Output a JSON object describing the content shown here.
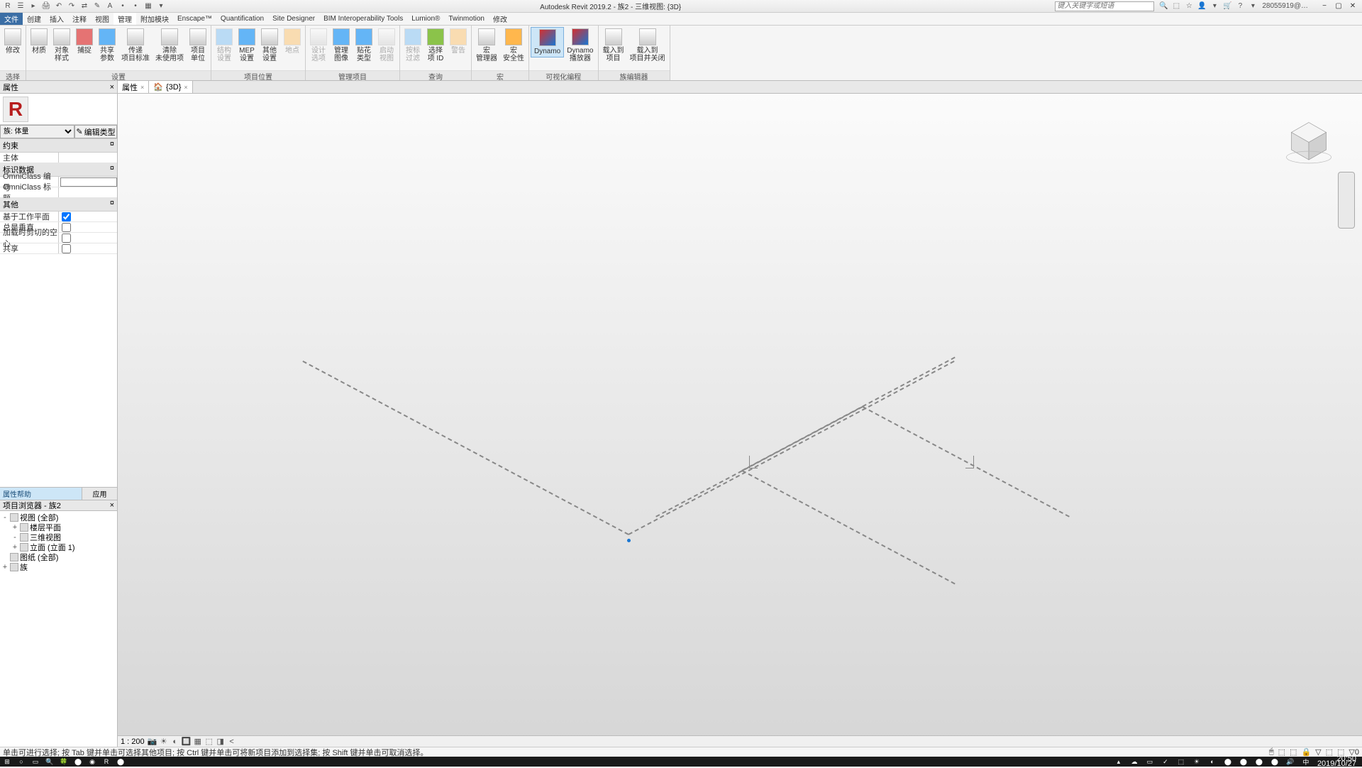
{
  "title": "Autodesk Revit 2019.2 - 族2 - 三维视图: {3D}",
  "qat": [
    "R",
    "☰",
    "▸",
    "🖨",
    "↶",
    "↷",
    "⇄",
    "✎",
    "A",
    "•",
    "•",
    "▦",
    "▾"
  ],
  "infocenter": {
    "search_placeholder": "键入关键字或短语",
    "user": "28055919@…",
    "icons": [
      "🔍",
      "⬚",
      "☆",
      "👤",
      "▾",
      "🛒",
      "?",
      "▾"
    ]
  },
  "tabs": [
    "文件",
    "创建",
    "插入",
    "注释",
    "视图",
    "管理",
    "附加模块",
    "Enscape™",
    "Quantification",
    "Site Designer",
    "BIM Interoperability Tools",
    "Lumion®",
    "Twinmotion",
    "修改"
  ],
  "active_tab": 5,
  "ribbon": [
    {
      "name": "选择",
      "btns": [
        {
          "l": "修改",
          "sub": "",
          "c": "c1"
        }
      ]
    },
    {
      "name": "设置",
      "btns": [
        {
          "l": "材质",
          "c": "c1"
        },
        {
          "l": "对象\n样式",
          "c": "c1"
        },
        {
          "l": "捕捉",
          "c": "c5"
        },
        {
          "l": "共享\n参数",
          "c": "c4"
        },
        {
          "l": "传递\n项目标准",
          "c": "c1"
        },
        {
          "l": "清除\n未使用项",
          "c": "c1"
        },
        {
          "l": "项目\n单位",
          "c": "c1"
        }
      ]
    },
    {
      "name": "项目位置",
      "btns": [
        {
          "l": "结构\n设置",
          "c": "c4",
          "d": true
        },
        {
          "l": "MEP\n设置",
          "c": "c4"
        },
        {
          "l": "其他\n设置",
          "c": "c1"
        },
        {
          "l": "地点",
          "c": "c3",
          "d": true
        }
      ]
    },
    {
      "name": "管理项目",
      "btns": [
        {
          "l": "设计\n选项",
          "c": "c1",
          "d": true
        },
        {
          "l": "管理\n图像",
          "c": "c4"
        },
        {
          "l": "贴花\n类型",
          "c": "c4"
        },
        {
          "l": "启动\n视图",
          "c": "c1",
          "d": true
        }
      ]
    },
    {
      "name": "查询",
      "btns": [
        {
          "l": "按标\n过滤",
          "c": "c4",
          "d": true
        },
        {
          "l": "选择\n项 ID",
          "c": "c2"
        },
        {
          "l": "警告",
          "c": "c3",
          "d": true
        }
      ]
    },
    {
      "name": "宏",
      "btns": [
        {
          "l": "宏\n管理器",
          "c": "c1"
        },
        {
          "l": "宏\n安全性",
          "c": "c3"
        }
      ]
    },
    {
      "name": "可视化编程",
      "btns": [
        {
          "l": "Dynamo",
          "c": "dyn",
          "hl": true
        },
        {
          "l": "Dynamo\n播放器",
          "c": "dyn"
        }
      ]
    },
    {
      "name": "族编辑器",
      "btns": [
        {
          "l": "载入到\n项目",
          "c": "c1"
        },
        {
          "l": "载入到\n项目并关闭",
          "c": "c1"
        }
      ]
    }
  ],
  "doc_tabs": [
    {
      "label": "属性",
      "close": true
    },
    {
      "label": "{3D}",
      "icon": "🏠",
      "close": true
    }
  ],
  "props": {
    "title": "属性",
    "selector": "族: 体量",
    "edit_type": "编辑类型",
    "sections": [
      {
        "name": "约束",
        "rows": [
          {
            "k": "主体",
            "v": ""
          }
        ]
      },
      {
        "name": "标识数据",
        "rows": [
          {
            "k": "OmniClass 编号",
            "v": "",
            "input": true
          },
          {
            "k": "OmniClass 标题",
            "v": ""
          }
        ]
      },
      {
        "name": "其他",
        "rows": [
          {
            "k": "基于工作平面",
            "cb": true,
            "checked": true
          },
          {
            "k": "总是垂直",
            "cb": true,
            "checked": false
          },
          {
            "k": "加载时剪切的空心",
            "cb": true,
            "checked": false
          },
          {
            "k": "共享",
            "cb": true,
            "checked": false
          }
        ]
      }
    ],
    "help": "属性帮助",
    "apply": "应用"
  },
  "browser": {
    "title": "项目浏览器 - 族2",
    "nodes": [
      {
        "l": "视图 (全部)",
        "d": 0,
        "exp": "-"
      },
      {
        "l": "楼层平面",
        "d": 1,
        "exp": "+"
      },
      {
        "l": "三维视图",
        "d": 1,
        "exp": "-"
      },
      {
        "l": "立面 (立面 1)",
        "d": 1,
        "exp": "+"
      },
      {
        "l": "图纸 (全部)",
        "d": 0,
        "exp": ""
      },
      {
        "l": "族",
        "d": 0,
        "exp": "+"
      }
    ]
  },
  "viewbar": {
    "scale": "1 : 200",
    "icons": [
      "📷",
      "☀",
      "◐",
      "🔲",
      "▦",
      "⬚",
      "◨",
      "<"
    ]
  },
  "status": "单击可进行选择; 按 Tab 键并单击可选择其他项目; 按 Ctrl 键并单击可将新项目添加到选择集; 按 Shift 键并单击可取消选择。",
  "status_right": [
    "🖱",
    "⬚",
    "⬚",
    "🔒",
    "▽",
    "⬚",
    "⬚",
    "▽0"
  ],
  "taskbar": {
    "left": [
      "⊞",
      "○",
      "▭",
      "🔍",
      "🍀",
      "⬤",
      "◉",
      "R",
      "⬤"
    ],
    "tray": [
      "▴",
      "☁",
      "▭",
      "✓",
      "⬚",
      "☀",
      "◐",
      "⬤",
      "⬤",
      "⬤",
      "⬤",
      "🔊",
      "中"
    ],
    "time": "20:50",
    "date": "2019/10/27"
  }
}
